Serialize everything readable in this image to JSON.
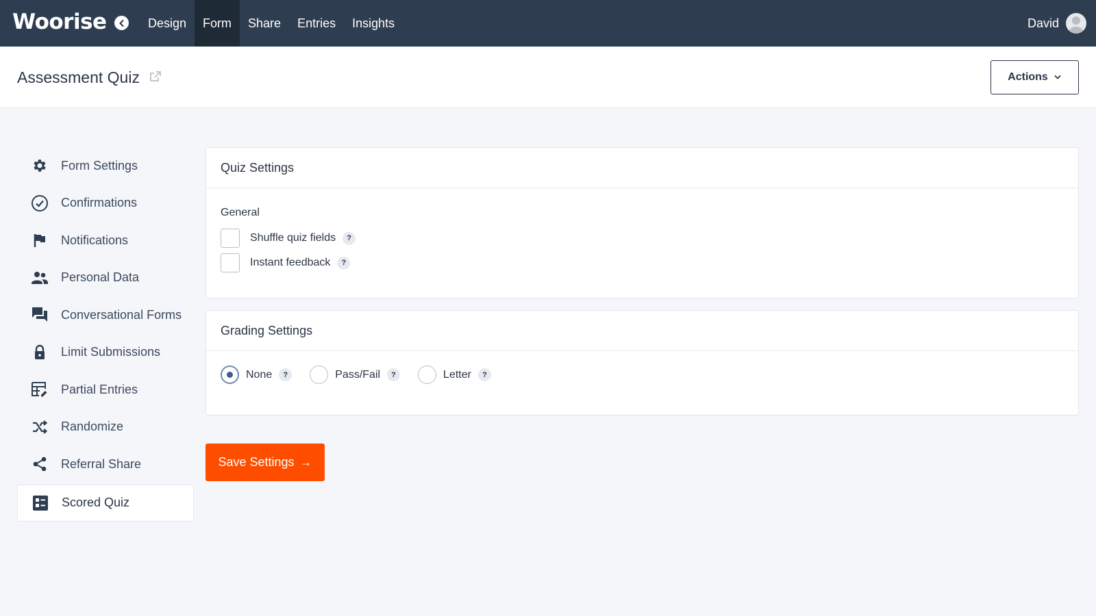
{
  "app": {
    "logo": "Woorise"
  },
  "nav": {
    "items": [
      {
        "label": "Design",
        "active": false
      },
      {
        "label": "Form",
        "active": true
      },
      {
        "label": "Share",
        "active": false
      },
      {
        "label": "Entries",
        "active": false
      },
      {
        "label": "Insights",
        "active": false
      }
    ]
  },
  "user": {
    "name": "David"
  },
  "header": {
    "title": "Assessment Quiz",
    "actions_label": "Actions"
  },
  "sidebar": {
    "items": [
      {
        "label": "Form Settings",
        "icon": "gear-icon"
      },
      {
        "label": "Confirmations",
        "icon": "check-circle-icon"
      },
      {
        "label": "Notifications",
        "icon": "flag-icon"
      },
      {
        "label": "Personal Data",
        "icon": "users-icon"
      },
      {
        "label": "Conversational Forms",
        "icon": "chat-icon"
      },
      {
        "label": "Limit Submissions",
        "icon": "lock-icon"
      },
      {
        "label": "Partial Entries",
        "icon": "table-edit-icon"
      },
      {
        "label": "Randomize",
        "icon": "shuffle-icon"
      },
      {
        "label": "Referral Share",
        "icon": "share-icon"
      },
      {
        "label": "Scored Quiz",
        "icon": "quiz-icon",
        "active": true
      }
    ]
  },
  "quiz_settings": {
    "title": "Quiz Settings",
    "group": "General",
    "options": [
      {
        "label": "Shuffle quiz fields",
        "checked": false,
        "help": "?"
      },
      {
        "label": "Instant feedback",
        "checked": false,
        "help": "?"
      }
    ]
  },
  "grading_settings": {
    "title": "Grading Settings",
    "options": [
      {
        "label": "None",
        "selected": true,
        "help": "?"
      },
      {
        "label": "Pass/Fail",
        "selected": false,
        "help": "?"
      },
      {
        "label": "Letter",
        "selected": false,
        "help": "?"
      }
    ]
  },
  "save": {
    "label": "Save Settings",
    "arrow": "→"
  },
  "colors": {
    "topbar": "#2e3d4f",
    "accent": "#ff4d00"
  }
}
